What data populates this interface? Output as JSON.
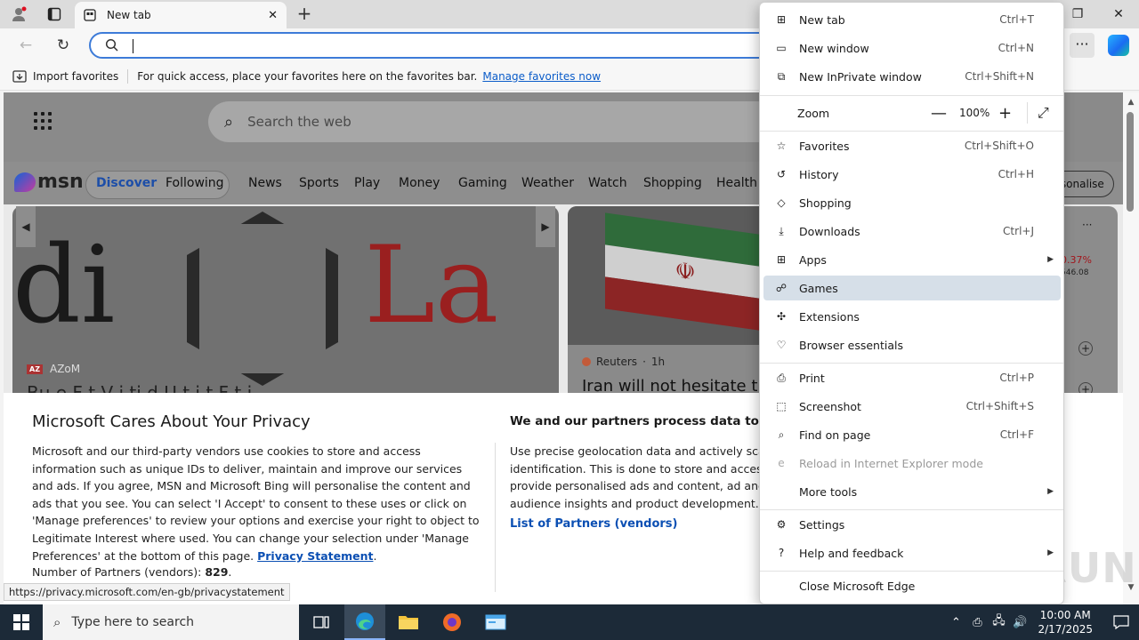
{
  "browser": {
    "tab_title": "New tab",
    "new_tab_symbol": "+",
    "window_buttons": [
      "—",
      "❐",
      "✕"
    ]
  },
  "favorites_bar": {
    "import_label": "Import favorites",
    "hint": "For quick access, place your favorites here on the favorites bar.",
    "manage_link": "Manage favorites now"
  },
  "page": {
    "search_placeholder": "Search the web",
    "msn_logo": "msn",
    "nav_tabs": [
      "Discover",
      "Following",
      "News",
      "Sports",
      "Play",
      "Money",
      "Gaming",
      "Weather",
      "Watch",
      "Shopping",
      "Health"
    ],
    "personalise_label": "rsonalise",
    "left_card": {
      "source_badge": "AZ",
      "source": "AZoM",
      "headline": "Bu    e   F   t   V   i  ti       d U   t  i t  F  t  i"
    },
    "right_card": {
      "source": "Reuters",
      "age": "1h",
      "headline": "Iran will not hesitate t"
    },
    "stock": {
      "pct": "0.37%",
      "value": "546.08"
    }
  },
  "privacy": {
    "title": "Microsoft Cares About Your Privacy",
    "body": "Microsoft and our third-party vendors use cookies to store and access information such as unique IDs to deliver, maintain and improve our services and ads. If you agree, MSN and Microsoft Bing will personalise the content and ads that you see. You can select 'I Accept' to consent to these uses or click on 'Manage preferences' to review your options and exercise your right to object to Legitimate Interest where used.  You can change your selection under 'Manage Preferences' at the bottom of this page. ",
    "statement_link": "Privacy Statement",
    "partners_label": "Number of Partners (vendors):",
    "partners_count": "829",
    "right_title": "We and our partners process data to provide:",
    "right_body_lines": [
      "Use precise geolocation data and actively scan d",
      "identification. This is done to store and access in",
      "provide personalised ads and content, ad and c",
      "audience insights and product development."
    ],
    "vendors_link": "List of Partners (vendors)"
  },
  "status_url": "https://privacy.microsoft.com/en-gb/privacystatement",
  "watermark": "ANY RUN",
  "menu": {
    "items": [
      {
        "label": "New tab",
        "shortcut": "Ctrl+T",
        "icon": "new-tab-icon",
        "glyph": "⊞"
      },
      {
        "label": "New window",
        "shortcut": "Ctrl+N",
        "icon": "new-window-icon",
        "glyph": "▭"
      },
      {
        "label": "New InPrivate window",
        "shortcut": "Ctrl+Shift+N",
        "icon": "inprivate-icon",
        "glyph": "⧉"
      },
      {
        "label": "Favorites",
        "shortcut": "Ctrl+Shift+O",
        "icon": "favorites-icon",
        "glyph": "☆"
      },
      {
        "label": "History",
        "shortcut": "Ctrl+H",
        "icon": "history-icon",
        "glyph": "↺"
      },
      {
        "label": "Shopping",
        "shortcut": "",
        "icon": "shopping-icon",
        "glyph": "◇"
      },
      {
        "label": "Downloads",
        "shortcut": "Ctrl+J",
        "icon": "downloads-icon",
        "glyph": "⤓"
      },
      {
        "label": "Apps",
        "shortcut": "",
        "icon": "apps-icon",
        "glyph": "⊞",
        "submenu": true
      },
      {
        "label": "Games",
        "shortcut": "",
        "icon": "games-icon",
        "glyph": "☍",
        "highlighted": true
      },
      {
        "label": "Extensions",
        "shortcut": "",
        "icon": "extensions-icon",
        "glyph": "✣"
      },
      {
        "label": "Browser essentials",
        "shortcut": "",
        "icon": "browser-essentials-icon",
        "glyph": "♡"
      },
      {
        "label": "Print",
        "shortcut": "Ctrl+P",
        "icon": "print-icon",
        "glyph": "⎙"
      },
      {
        "label": "Screenshot",
        "shortcut": "Ctrl+Shift+S",
        "icon": "screenshot-icon",
        "glyph": "⬚"
      },
      {
        "label": "Find on page",
        "shortcut": "Ctrl+F",
        "icon": "find-icon",
        "glyph": "⌕"
      },
      {
        "label": "Reload in Internet Explorer mode",
        "shortcut": "",
        "icon": "ie-mode-icon",
        "glyph": "e",
        "disabled": true
      },
      {
        "label": "More tools",
        "shortcut": "",
        "icon": "",
        "glyph": "",
        "submenu": true
      },
      {
        "label": "Settings",
        "shortcut": "",
        "icon": "settings-icon",
        "glyph": "⚙"
      },
      {
        "label": "Help and feedback",
        "shortcut": "",
        "icon": "help-icon",
        "glyph": "?",
        "submenu": true
      },
      {
        "label": "Close Microsoft Edge",
        "shortcut": "",
        "icon": "",
        "glyph": ""
      }
    ],
    "zoom": {
      "label": "Zoom",
      "value": "100%",
      "minus": "—",
      "plus": "+",
      "fullscreen": "⤢"
    }
  },
  "taskbar": {
    "search_placeholder": "Type here to search",
    "time": "10:00 AM",
    "date": "2/17/2025"
  }
}
